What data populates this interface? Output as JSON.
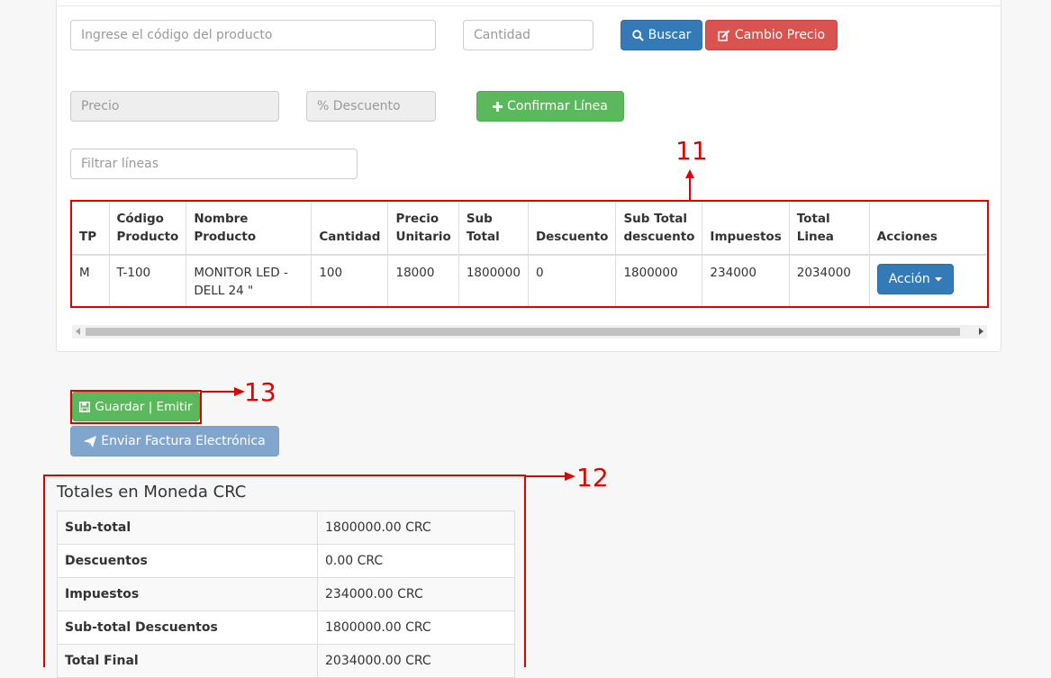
{
  "form": {
    "codigo_placeholder": "Ingrese el código del producto",
    "cantidad_placeholder": "Cantidad",
    "buscar_label": "Buscar",
    "cambio_precio_label": "Cambio Precio",
    "precio_placeholder": "Precio",
    "descuento_placeholder": "% Descuento",
    "confirmar_label": "Confirmar Línea",
    "filtrar_placeholder": "Filtrar líneas"
  },
  "lines_table": {
    "headers": [
      "TP",
      "Código Producto",
      "Nombre Producto",
      "Cantidad",
      "Precio Unitario",
      "Sub Total",
      "Descuento",
      "Sub Total descuento",
      "Impuestos",
      "Total Linea",
      "Acciones"
    ],
    "rows": [
      {
        "tp": "M",
        "codigo": "T-100",
        "nombre": "MONITOR LED - DELL 24 \"",
        "cantidad": "100",
        "precio_unitario": "18000",
        "sub_total": "1800000",
        "descuento": "0",
        "sub_total_descuento": "1800000",
        "impuestos": "234000",
        "total_linea": "2034000",
        "accion_label": "Acción"
      }
    ]
  },
  "actions": {
    "guardar_label": "Guardar | Emitir",
    "enviar_label": "Enviar Factura Electrónica"
  },
  "totals": {
    "title": "Totales en Moneda CRC",
    "rows": [
      {
        "label": "Sub-total",
        "value": "1800000.00 CRC"
      },
      {
        "label": "Descuentos",
        "value": "0.00 CRC"
      },
      {
        "label": "Impuestos",
        "value": "234000.00 CRC"
      },
      {
        "label": "Sub-total Descuentos",
        "value": "1800000.00 CRC"
      },
      {
        "label": "Total Final",
        "value": "2034000.00 CRC"
      }
    ]
  },
  "annotations": {
    "lines_table": "11",
    "totals": "12",
    "guardar": "13"
  },
  "colors": {
    "primary": "#337ab7",
    "danger": "#d9534f",
    "success": "#5cb85c",
    "annotation": "#e00000"
  }
}
